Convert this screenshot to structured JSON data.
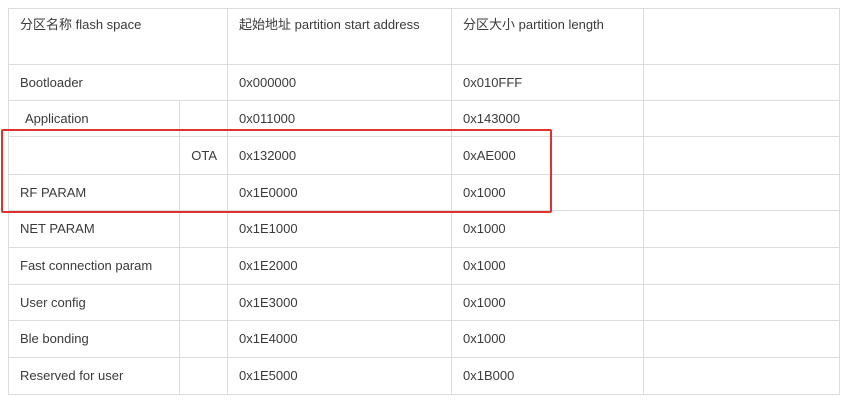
{
  "table": {
    "headers": {
      "name": "分区名称 flash space",
      "start": "起始地址 partition start address",
      "length": "分区大小 partition length",
      "extra": ""
    },
    "rows": [
      {
        "name": "Bootloader",
        "sub": "",
        "start": "0x000000",
        "length": "0x010FFF"
      },
      {
        "name": "Application",
        "sub": "",
        "start": "0x011000",
        "length": "0x143000"
      },
      {
        "name": "",
        "sub": "OTA",
        "start": "0x132000",
        "length": "0xAE000"
      },
      {
        "name": "RF PARAM",
        "sub": "",
        "start": "0x1E0000",
        "length": "0x1000"
      },
      {
        "name": "NET PARAM",
        "sub": "",
        "start": "0x1E1000",
        "length": "0x1000"
      },
      {
        "name": "Fast connection param",
        "sub": "",
        "start": "0x1E2000",
        "length": "0x1000"
      },
      {
        "name": "User config",
        "sub": "",
        "start": "0x1E3000",
        "length": "0x1000"
      },
      {
        "name": "Ble bonding",
        "sub": "",
        "start": "0x1E4000",
        "length": "0x1000"
      },
      {
        "name": "Reserved for user",
        "sub": "",
        "start": "0x1E5000",
        "length": "0x1B000"
      }
    ]
  },
  "highlight": {
    "color": "#e03131"
  }
}
